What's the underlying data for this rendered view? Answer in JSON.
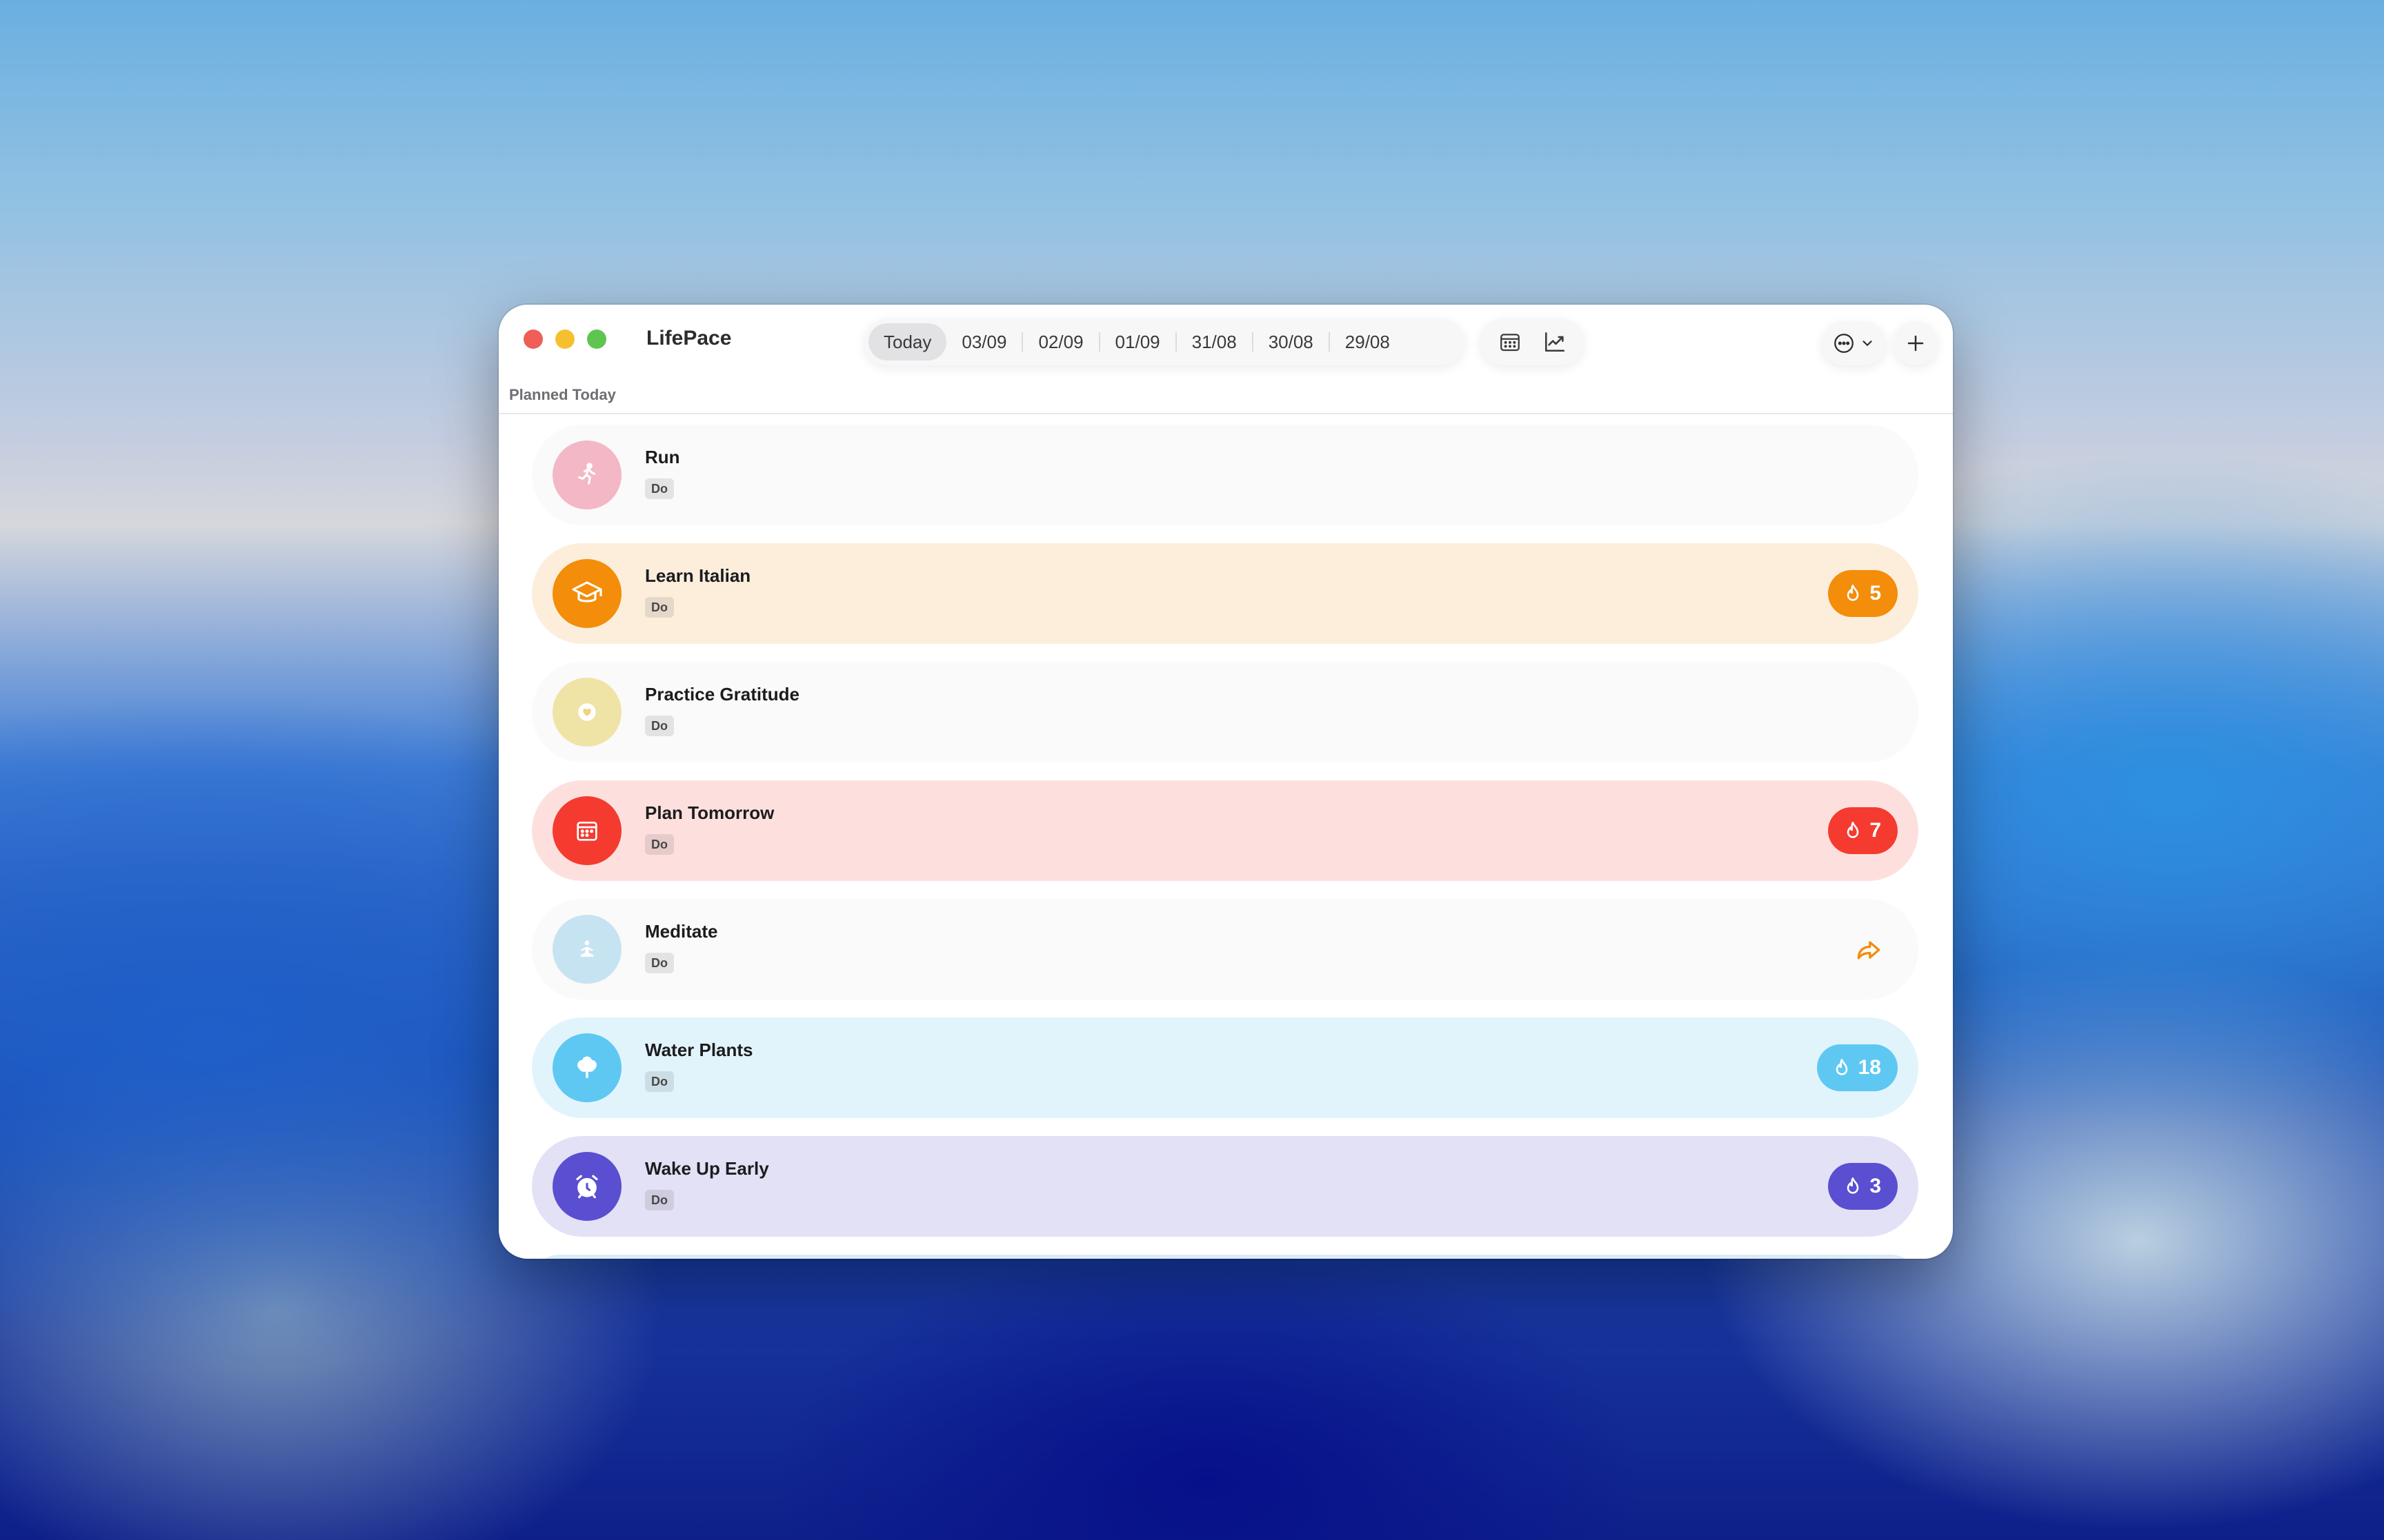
{
  "window": {
    "app_title": "LifePace",
    "section_title": "Planned Today"
  },
  "toolbar": {
    "date_tabs": [
      {
        "label": "Today",
        "active": true
      },
      {
        "label": "03/09",
        "active": false
      },
      {
        "label": "02/09",
        "active": false
      },
      {
        "label": "01/09",
        "active": false
      },
      {
        "label": "31/08",
        "active": false
      },
      {
        "label": "30/08",
        "active": false
      },
      {
        "label": "29/08",
        "active": false
      }
    ],
    "view_icons": [
      "calendar-icon",
      "chart-line-icon"
    ],
    "more_icon": "ellipsis-circle-icon",
    "add_icon": "plus-icon"
  },
  "habits": [
    {
      "name": "Run",
      "tag": "Do",
      "icon": "running-icon",
      "color": "#f4b7c5",
      "bg": "#fafafa",
      "streak": null,
      "share": false
    },
    {
      "name": "Learn Italian",
      "tag": "Do",
      "icon": "graduation-cap-icon",
      "color": "#f38d0a",
      "bg": "#fdeedc",
      "streak": "5",
      "share": false
    },
    {
      "name": "Practice Gratitude",
      "tag": "Do",
      "icon": "heart-icon",
      "color": "#f0e3a6",
      "bg": "#fafafa",
      "streak": null,
      "share": false
    },
    {
      "name": "Plan Tomorrow",
      "tag": "Do",
      "icon": "calendar-icon",
      "color": "#f53b30",
      "bg": "#fde0de",
      "streak": "7",
      "share": false
    },
    {
      "name": "Meditate",
      "tag": "Do",
      "icon": "meditation-icon",
      "color": "#c6e3f1",
      "bg": "#fafafa",
      "streak": null,
      "share": true
    },
    {
      "name": "Water Plants",
      "tag": "Do",
      "icon": "tree-icon",
      "color": "#5ec8f3",
      "bg": "#e1f4fc",
      "streak": "18",
      "share": false
    },
    {
      "name": "Wake Up Early",
      "tag": "Do",
      "icon": "alarm-clock-icon",
      "color": "#5a4fd0",
      "bg": "#e3e1f5",
      "streak": "3",
      "share": false
    }
  ]
}
